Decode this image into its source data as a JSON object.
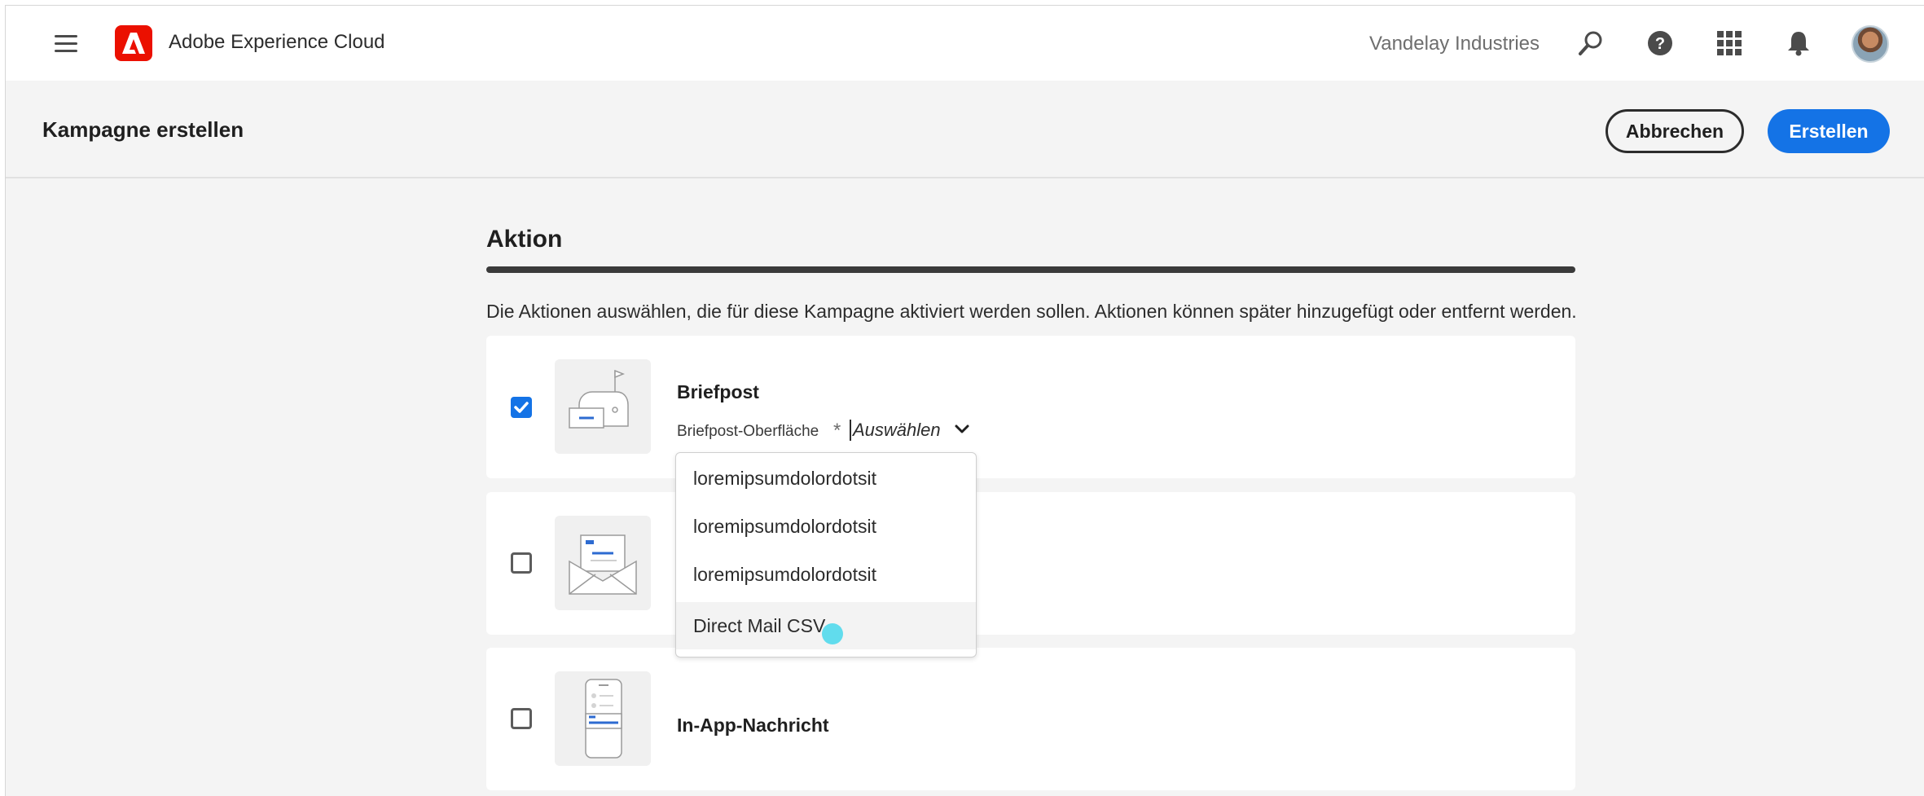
{
  "appbar": {
    "app_name": "Adobe Experience Cloud",
    "org_name": "Vandelay Industries",
    "icons": [
      "menu-icon",
      "adobe-logo-icon",
      "search-icon",
      "help-icon",
      "apps-grid-icon",
      "bell-icon",
      "avatar"
    ]
  },
  "header": {
    "title": "Kampagne erstellen",
    "cancel_label": "Abbrechen",
    "create_label": "Erstellen"
  },
  "section": {
    "title": "Aktion",
    "description": "Die Aktionen auswählen, die für diese Kampagne aktiviert werden sollen. Aktionen können später hinzugefügt oder entfernt werden."
  },
  "actions": [
    {
      "name": "Briefpost",
      "checked": true,
      "thumbnail_icon": "mailbox-icon",
      "field_label": "Briefpost-Oberfläche",
      "required_marker": "*",
      "picker_value": "Auswählen"
    },
    {
      "name": "",
      "checked": false,
      "thumbnail_icon": "email-envelope-icon"
    },
    {
      "name": "In-App-Nachricht",
      "checked": false,
      "thumbnail_icon": "mobile-phone-icon"
    }
  ],
  "dropdown": {
    "options": [
      "loremipsumdolordotsit",
      "loremipsumdolordotsit",
      "loremipsumdolordotsit",
      "Direct Mail CSV"
    ],
    "hovered_index": 3
  },
  "colors": {
    "accent": "#1473e6",
    "adobe_red": "#eb1000",
    "cursor": "#46d7eb"
  }
}
